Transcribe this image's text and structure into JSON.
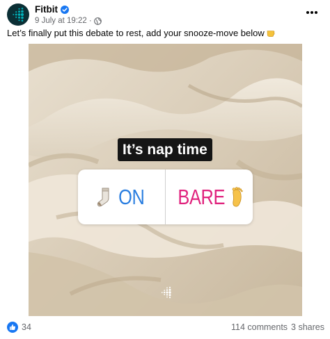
{
  "post": {
    "page_name": "Fitbit",
    "timestamp": "9 July at 19:22",
    "separator": "·",
    "caption": "Let’s finally put this debate to rest, add your snooze-move below"
  },
  "media": {
    "banner": "It’s nap time",
    "poll": {
      "option_on": "ON",
      "option_bare": "BARE"
    }
  },
  "footer": {
    "like_count": "34",
    "comments": "114 comments",
    "shares": "3 shares"
  },
  "colors": {
    "brand_teal": "#00b0b9",
    "avatar_bg": "#0b2f35",
    "poll_on": "#2a7ee0",
    "poll_bare": "#e0227d",
    "like_blue": "#1877f2"
  },
  "icons": [
    "fitbit-logo-icon",
    "verified-icon",
    "globe-icon",
    "more-options-icon",
    "pointing-hand-icon",
    "sock-icon",
    "foot-icon",
    "like-icon"
  ]
}
